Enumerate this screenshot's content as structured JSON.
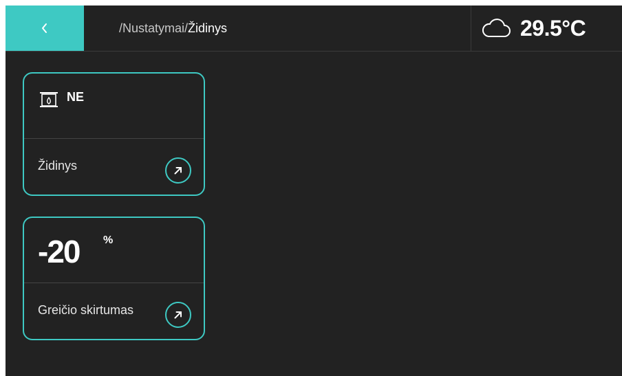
{
  "header": {
    "breadcrumb_path": "/Nustatymai/",
    "breadcrumb_current": "Židinys",
    "temperature": "29.5°C",
    "weather_icon": "cloud-icon",
    "back_icon": "chevron-left-icon"
  },
  "cards": [
    {
      "icon": "fireplace-icon",
      "value": "NE",
      "label": "Židinys",
      "action_icon": "arrow-up-right-icon"
    },
    {
      "value": "-20",
      "unit": "%",
      "label": "Greičio skirtumas",
      "action_icon": "arrow-up-right-icon"
    }
  ],
  "colors": {
    "accent": "#3ec9c3",
    "background": "#222222",
    "text": "#ffffff"
  }
}
